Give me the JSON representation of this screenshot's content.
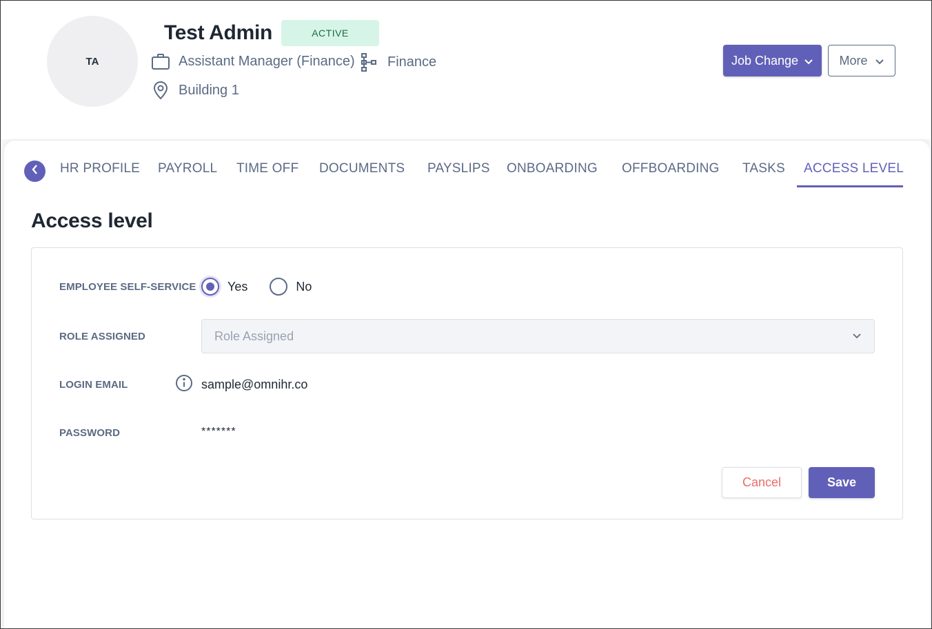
{
  "colors": {
    "accent": "#6160b8",
    "active_badge_bg": "#d6f5e8",
    "cancel_text": "#ec6b6b",
    "muted_text": "#5b6a84"
  },
  "profile": {
    "initials": "TA",
    "name": "Test Admin",
    "status": "ACTIVE",
    "job_title": "Assistant Manager (Finance)",
    "department": "Finance",
    "location": "Building 1",
    "icons": {
      "job_title": "briefcase-icon",
      "department": "org-chart-icon",
      "location": "map-pin-icon"
    }
  },
  "header_actions": {
    "job_change_label": "Job Change",
    "more_label": "More"
  },
  "tabs": [
    {
      "label": "HR PROFILE",
      "active": false
    },
    {
      "label": "PAYROLL",
      "active": false
    },
    {
      "label": "TIME OFF",
      "active": false
    },
    {
      "label": "DOCUMENTS",
      "active": false
    },
    {
      "label": "PAYSLIPS",
      "active": false
    },
    {
      "label": "ONBOARDING",
      "active": false
    },
    {
      "label": "OFFBOARDING",
      "active": false
    },
    {
      "label": "TASKS",
      "active": false
    },
    {
      "label": "ACCESS LEVEL",
      "active": true
    }
  ],
  "access_level": {
    "title": "Access level",
    "employee_self_service": {
      "label": "EMPLOYEE SELF-SERVICE",
      "options": [
        {
          "label": "Yes",
          "selected": true
        },
        {
          "label": "No",
          "selected": false
        }
      ]
    },
    "role_assigned": {
      "label": "ROLE ASSIGNED",
      "placeholder": "Role Assigned"
    },
    "login_email": {
      "label": "LOGIN EMAIL",
      "value": "sample@omnihr.co"
    },
    "password": {
      "label": "PASSWORD",
      "value": "*******"
    },
    "cancel_label": "Cancel",
    "save_label": "Save"
  }
}
